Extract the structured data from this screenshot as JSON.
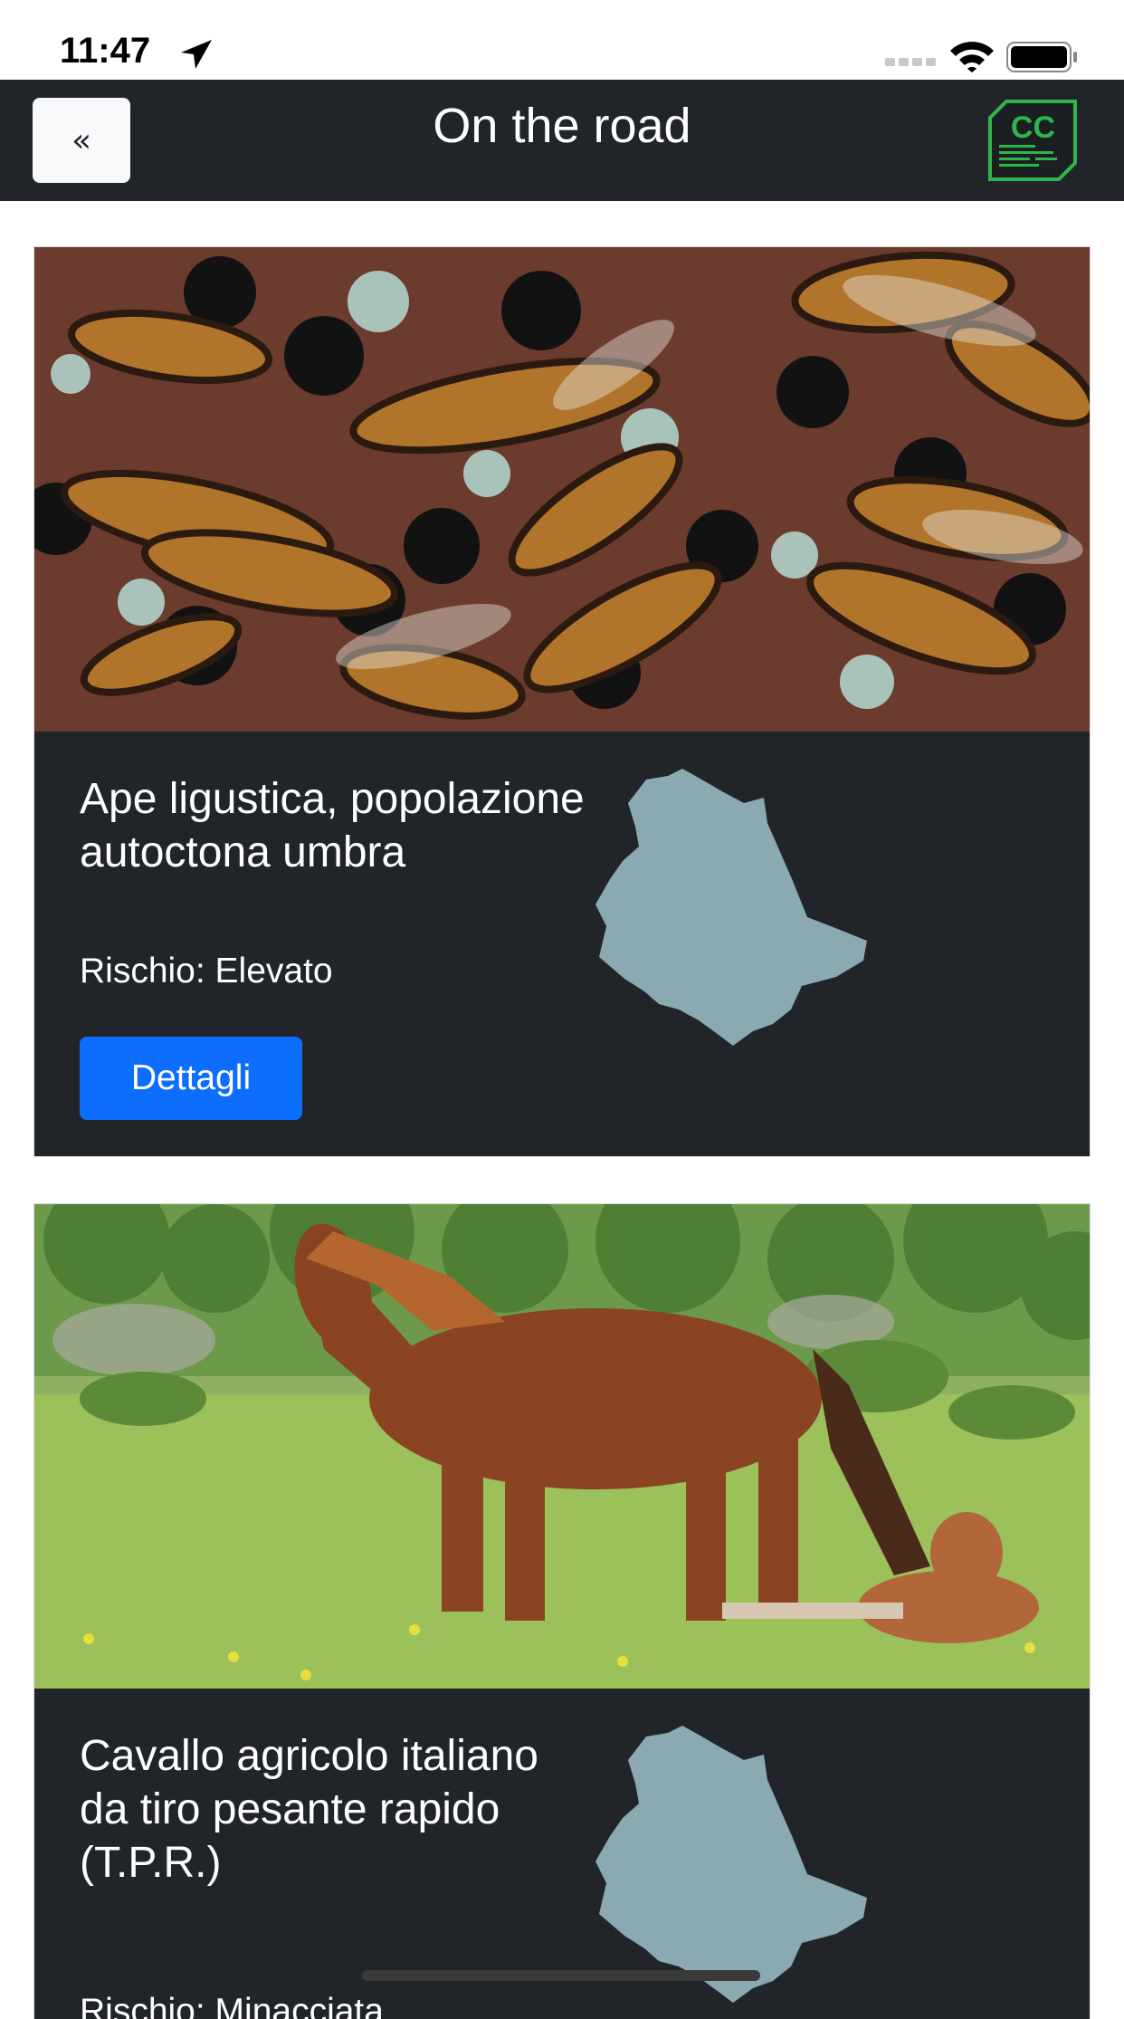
{
  "status_bar": {
    "time": "11:47",
    "icons": [
      "location-arrow-icon",
      "signal-icon",
      "wifi-icon",
      "battery-icon"
    ]
  },
  "navbar": {
    "back_label": "«",
    "title": "On the road",
    "logo_text": "CC"
  },
  "cards": [
    {
      "title": "Ape ligustica, popolazione autoctona umbra",
      "risk": "Rischio: Elevato",
      "button_label": "Dettagli",
      "image": "bees-on-honeycomb",
      "region": "umbria-map"
    },
    {
      "title": "Cavallo agricolo italiano da tiro pesante rapido (T.P.R.)",
      "risk": "Rischio: Minacciata",
      "image": "horse-and-foal-in-meadow",
      "region": "umbria-map"
    }
  ],
  "colors": {
    "navbar_bg": "#212529",
    "card_bg": "#212529",
    "button_bg": "#0d6efd",
    "map_fill": "#8aa9b1",
    "logo_green": "#2fb54a"
  }
}
